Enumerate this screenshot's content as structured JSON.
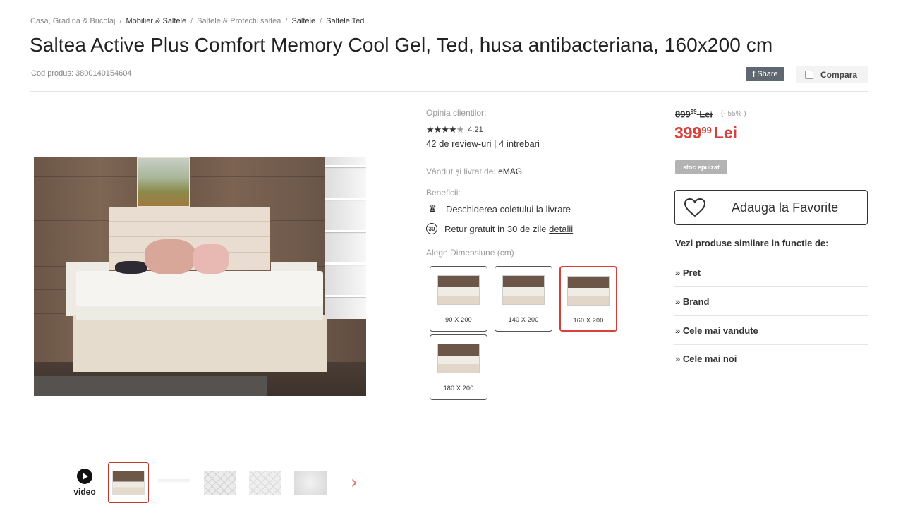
{
  "breadcrumb": [
    {
      "label": "Casa, Gradina & Bricolaj",
      "tone": "muted"
    },
    {
      "label": "Mobilier & Saltele",
      "tone": "dark"
    },
    {
      "label": "Saltele & Protectii saltea",
      "tone": "muted"
    },
    {
      "label": "Saltele",
      "tone": "dark"
    },
    {
      "label": "Saltele Ted",
      "tone": "dark"
    }
  ],
  "product": {
    "title": "Saltea Active Plus Comfort Memory Cool Gel, Ted, husa antibacteriana, 160x200 cm",
    "code_text": "Cod produs: 3800140154604"
  },
  "actions": {
    "share_label": "Share",
    "compare_label": "Compara"
  },
  "gallery": {
    "video_label": "video",
    "thumbnails": [
      "bed",
      "mattress",
      "quilt-top",
      "quilt-close",
      "foam"
    ]
  },
  "reviews": {
    "heading": "Opinia clientilor:",
    "rating": "4.21",
    "rating_value": 4.21,
    "summary": "42 de review-uri | 4 intrebari"
  },
  "seller": {
    "label": "Vândut și livrat de:",
    "name": "eMAG"
  },
  "benefits": {
    "heading": "Beneficii:",
    "item1": "Deschiderea coletului la livrare",
    "item2": "Retur gratuit in 30 de zile",
    "item2_link": "detalii",
    "badge30": "30"
  },
  "sizes": {
    "heading": "Alege Dimensiune (cm)",
    "options": [
      "90 X 200",
      "140 X 200",
      "160 X 200",
      "180 X 200"
    ],
    "selected": "160 X 200"
  },
  "price": {
    "old_int": "899",
    "old_dec": "99",
    "old_cur": "Lei",
    "discount": "(- 55% )",
    "new_int": "399",
    "new_dec": "99",
    "new_cur": "Lei",
    "stock": "stoc epuizat"
  },
  "favorite": {
    "label": "Adauga la Favorite"
  },
  "similar": {
    "title": "Vezi produse similare in functie de:",
    "items": [
      "» Pret",
      "» Brand",
      "» Cele mai vandute",
      "» Cele mai noi"
    ]
  },
  "colors": {
    "accent": "#d9403a",
    "text": "#333333",
    "muted": "#999999"
  }
}
